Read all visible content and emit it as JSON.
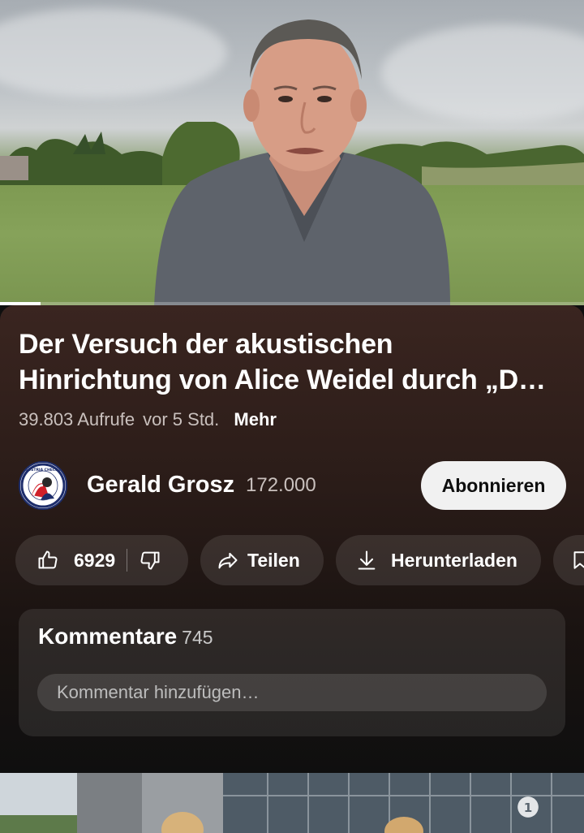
{
  "player": {
    "progress": 0.07
  },
  "video": {
    "title_line1": "Der Versuch der akustischen",
    "title_line2": "Hinrichtung von Alice Weidel durch „D…",
    "views": "39.803 Aufrufe",
    "age": "vor 5 Std.",
    "more_label": "Mehr"
  },
  "channel": {
    "name": "Gerald Grosz",
    "subscribers": "172.000",
    "subscribe_label": "Abonnieren",
    "avatar_text": "FREIE AUSTRIA CHECKS GROSZ"
  },
  "actions": {
    "likes": "6929",
    "share_label": "Teilen",
    "download_label": "Herunterladen"
  },
  "comments": {
    "title": "Kommentare",
    "count": "745",
    "placeholder": "Kommentar hinzufügen…"
  },
  "icons": {
    "like": "thumbs-up-icon",
    "dislike": "thumbs-down-icon",
    "share": "share-arrow-icon",
    "download": "download-icon",
    "save": "bookmark-icon",
    "broadcaster": "ard-logo-icon"
  },
  "colors": {
    "subscribe_bg": "#f1f1f1",
    "page_bg": "#0f0f0f",
    "details_tint": "#3a2520"
  }
}
